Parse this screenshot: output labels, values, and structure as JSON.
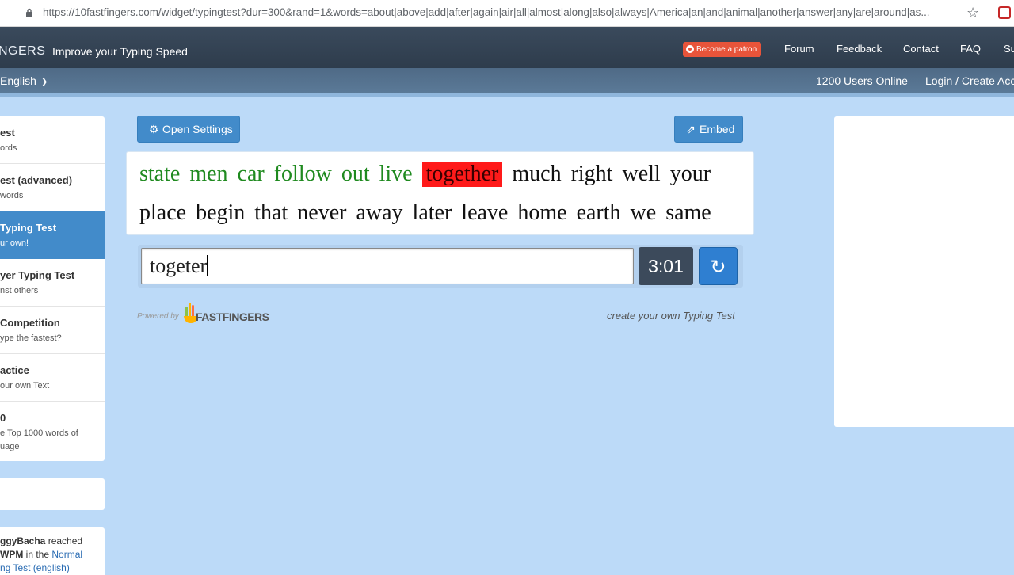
{
  "browser": {
    "url": "https://10fastfingers.com/widget/typingtest?dur=300&rand=1&words=about|above|add|after|again|air|all|almost|along|also|always|America|an|and|animal|another|answer|any|are|around|as..."
  },
  "header": {
    "brand": "NGERS",
    "tagline": "Improve your Typing Speed",
    "patron_label": "Become a patron",
    "nav": [
      "Forum",
      "Feedback",
      "Contact",
      "FAQ",
      "Su"
    ]
  },
  "subbar": {
    "language": "English",
    "users_online": "1200 Users Online",
    "login": "Login / Create Acc"
  },
  "sidebar": {
    "items": [
      {
        "title": "est",
        "sub": "ords",
        "sub2": ""
      },
      {
        "title": "est (advanced)",
        "sub": "words",
        "sub2": ""
      },
      {
        "title": " Typing Test",
        "sub": "ur own!",
        "sub2": ""
      },
      {
        "title": "yer Typing Test",
        "sub": "nst others",
        "sub2": ""
      },
      {
        "title": "Competition",
        "sub": "ype the fastest?",
        "sub2": ""
      },
      {
        "title": "actice",
        "sub": "our own Text",
        "sub2": ""
      },
      {
        "title": "0",
        "sub": "e Top 1000 words of",
        "sub2": "uage"
      }
    ],
    "activity": {
      "user": "ggyBacha",
      "reached": " reached",
      "wpm": "WPM",
      "in_the": " in the ",
      "link1": "Normal",
      "link2": "ng Test (english)"
    }
  },
  "toolbar": {
    "settings_label": "Open Settings",
    "embed_label": "Embed"
  },
  "test": {
    "line1_done": [
      "state",
      "men",
      "car",
      "follow",
      "out",
      "live"
    ],
    "current_word": "together",
    "line1_rest": [
      "much",
      "right",
      "well",
      "your"
    ],
    "line2": [
      "place",
      "begin",
      "that",
      "never",
      "away",
      "later",
      "leave",
      "home",
      "earth",
      "we",
      "same"
    ],
    "typed": "togeter",
    "timer": "3:01",
    "reload_glyph": "↻"
  },
  "footer": {
    "powered_by": "Powered by",
    "logo_text": "FASTFINGERS",
    "create_link": "create your own Typing Test"
  },
  "colors": {
    "accent": "#428bca",
    "correct": "#1f8a1f",
    "current_highlight": "#ff1a1a"
  }
}
